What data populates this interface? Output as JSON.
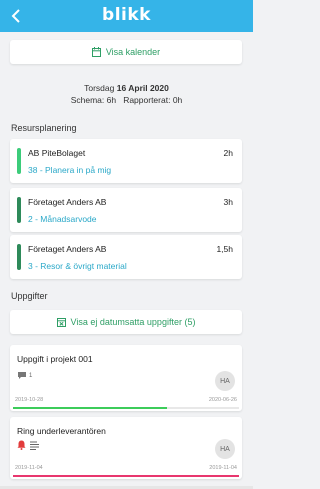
{
  "header": {
    "logo": "blikk"
  },
  "calendar_button": {
    "label": "Visa kalender"
  },
  "day": {
    "weekday": "Torsdag",
    "date": "16 April 2020",
    "schedule_label": "Schema:",
    "schedule_value": "6h",
    "reported_label": "Rapporterat:",
    "reported_value": "0h"
  },
  "resource_section": {
    "title": "Resursplanering"
  },
  "resources": [
    {
      "company": "AB PiteBolaget",
      "hours": "2h",
      "project": "38 - Planera in på mig",
      "bar_color": "#3ccc7a"
    },
    {
      "company": "Företaget Anders AB",
      "hours": "3h",
      "project": "2 - Månadsarvode",
      "bar_color": "#2e8a5a"
    },
    {
      "company": "Företaget Anders AB",
      "hours": "1,5h",
      "project": "3 - Resor & övrigt material",
      "bar_color": "#2e8a5a"
    }
  ],
  "tasks_section": {
    "title": "Uppgifter"
  },
  "undated_button": {
    "label": "Visa ej datumsatta uppgifter (5)"
  },
  "tasks": [
    {
      "title": "Uppgift i projekt 001",
      "comment_count": "1",
      "avatar": "HA",
      "start": "2019-10-28",
      "end": "2020-06-26",
      "progress": 0.68,
      "progress_color": "#3ccc5a"
    },
    {
      "title": "Ring underleverantören",
      "avatar": "HA",
      "start": "2019-11-04",
      "end": "2019-11-04",
      "progress": 1.0,
      "progress_color": "#e8366e"
    }
  ],
  "colors": {
    "header": "#35b4e8",
    "accent_green": "#2e9e65",
    "link_blue": "#2aa8c8",
    "alert_red": "#e23b3b"
  }
}
